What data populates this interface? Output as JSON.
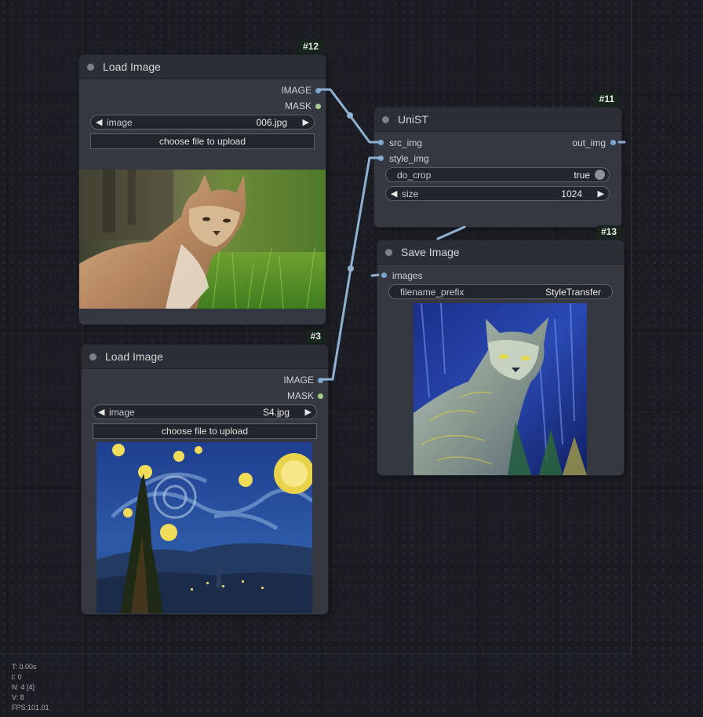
{
  "nodes": {
    "load1": {
      "id": "#12",
      "title": "Load Image",
      "outputs": [
        "IMAGE",
        "MASK"
      ],
      "image_label": "image",
      "image_value": "006.jpg",
      "upload_label": "choose file to upload"
    },
    "load2": {
      "id": "#3",
      "title": "Load Image",
      "outputs": [
        "IMAGE",
        "MASK"
      ],
      "image_label": "image",
      "image_value": "S4.jpg",
      "upload_label": "choose file to upload"
    },
    "unist": {
      "id": "#11",
      "title": "UniST",
      "inputs": [
        "src_img",
        "style_img"
      ],
      "output": "out_img",
      "do_crop_label": "do_crop",
      "do_crop_value": "true",
      "size_label": "size",
      "size_value": "1024"
    },
    "save": {
      "id": "#13",
      "title": "Save Image",
      "input": "images",
      "prefix_label": "filename_prefix",
      "prefix_value": "StyleTransfer"
    }
  },
  "stats": {
    "t": "T: 0.00s",
    "i": "I: 0",
    "n": "N: 4 [4]",
    "v": "V: 8",
    "fps": "FPS:101.01"
  },
  "colors": {
    "canvas": "#1b1d23",
    "node_body": "#353840",
    "node_header": "#2b2e35",
    "image_link": "#79a4d0",
    "mask_slot": "#a5cf8f",
    "id_badge": "#16251c"
  },
  "icons": [
    "arrow-left-icon",
    "arrow-right-icon",
    "node-collapse-dot-icon"
  ]
}
